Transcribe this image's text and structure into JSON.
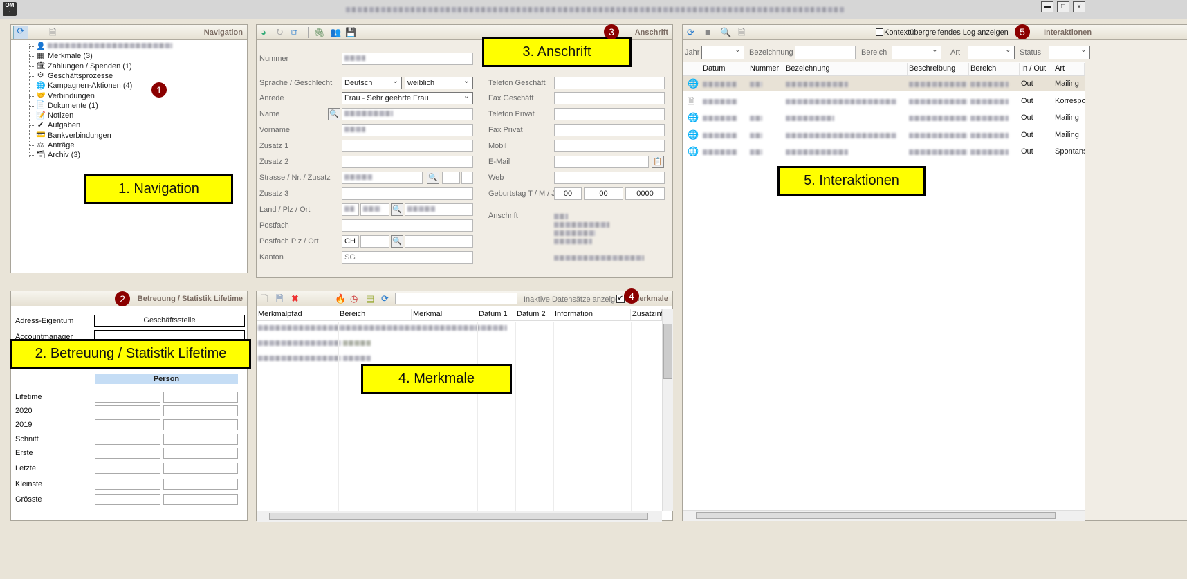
{
  "window": {
    "logo": "OM",
    "controls": [
      "▬",
      "□",
      "x"
    ]
  },
  "navigation": {
    "title": "Navigation",
    "badge": "1",
    "callout": "1. Navigation",
    "items": [
      {
        "label": "",
        "icon": "person-icon",
        "glyph": "👤"
      },
      {
        "label": "Merkmale (3)",
        "icon": "blocks-icon",
        "glyph": "▦"
      },
      {
        "label": "Zahlungen / Spenden (1)",
        "icon": "bank-icon",
        "glyph": "🏛"
      },
      {
        "label": "Geschäftsprozesse",
        "icon": "gear-icon",
        "glyph": "⚙"
      },
      {
        "label": "Kampagnen-Aktionen (4)",
        "icon": "globe-icon",
        "glyph": "🌐"
      },
      {
        "label": "Verbindungen",
        "icon": "handshake-icon",
        "glyph": "🤝"
      },
      {
        "label": "Dokumente (1)",
        "icon": "document-icon",
        "glyph": "📄"
      },
      {
        "label": "Notizen",
        "icon": "note-icon",
        "glyph": "📝"
      },
      {
        "label": "Aufgaben",
        "icon": "checkmark-icon",
        "glyph": "✔"
      },
      {
        "label": "Bankverbindungen",
        "icon": "card-icon",
        "glyph": "💳"
      },
      {
        "label": "Anträge",
        "icon": "stamp-icon",
        "glyph": "⚖"
      },
      {
        "label": "Archiv (3)",
        "icon": "archive-icon",
        "glyph": "🗃"
      }
    ]
  },
  "betreuung": {
    "title": "Betreuung / Statistik Lifetime",
    "badge": "2",
    "callout": "2. Betreuung / Statistik Lifetime",
    "adress_eigentum_label": "Adress-Eigentum",
    "adress_eigentum_value": "Geschäftsstelle",
    "accountmanager_label": "Accountmanager",
    "person_header": "Person",
    "rows": [
      "Lifetime",
      "2020",
      "2019",
      "Schnitt",
      "Erste",
      "Letzte",
      "Kleinste",
      "Grösste"
    ]
  },
  "anschrift": {
    "title": "Anschrift",
    "badge": "3",
    "callout": "3. Anschrift",
    "left": [
      {
        "label": "Nummer"
      },
      {
        "label": "Sprache / Geschlecht",
        "value1": "Deutsch",
        "value2": "weiblich"
      },
      {
        "label": "Anrede",
        "value": "Frau -  Sehr geehrte Frau"
      },
      {
        "label": "Name"
      },
      {
        "label": "Vorname"
      },
      {
        "label": "Zusatz 1"
      },
      {
        "label": "Zusatz 2"
      },
      {
        "label": "Strasse / Nr. / Zusatz"
      },
      {
        "label": "Zusatz 3"
      },
      {
        "label": "Land / Plz / Ort"
      },
      {
        "label": "Postfach"
      },
      {
        "label": "Postfach Plz / Ort",
        "value": "CH"
      },
      {
        "label": "Kanton",
        "value": "SG"
      }
    ],
    "right": [
      "Telefon Geschäft",
      "Fax Geschäft",
      "Telefon Privat",
      "Fax Privat",
      "Mobil",
      "E-Mail",
      "Web",
      "Geburtstag  T / M / J"
    ],
    "birthday": [
      "00",
      "00",
      "0000"
    ],
    "address_label": "Anschrift"
  },
  "merkmale": {
    "title": "Merkmale",
    "badge": "4",
    "callout": "4. Merkmale",
    "inactive_label": "Inaktive Datensätze anzeigen",
    "inactive_checked": true,
    "search_value": "",
    "columns": [
      "Merkmalpfad",
      "Bereich",
      "Merkmal",
      "Datum 1",
      "Datum 2",
      "Information",
      "Zusatzinfo"
    ]
  },
  "interaktionen": {
    "title": "Interaktionen",
    "badge": "5",
    "callout": "5. Interaktionen",
    "context_log_label": "Kontextübergreifendes Log anzeigen",
    "context_log_checked": false,
    "filters": {
      "jahr": "Jahr",
      "bezeichnung": "Bezeichnung",
      "bereich": "Bereich",
      "art": "Art",
      "status": "Status"
    },
    "columns": [
      "Datum",
      "Nummer",
      "Bezeichnung",
      "Beschreibung",
      "Bereich",
      "In / Out",
      "Art"
    ],
    "rows": [
      {
        "icon": "globe-icon",
        "in_out": "Out",
        "art": "Mailing"
      },
      {
        "icon": "document-icon",
        "in_out": "Out",
        "art": "Korrespondenz"
      },
      {
        "icon": "globe-icon",
        "in_out": "Out",
        "art": "Mailing"
      },
      {
        "icon": "globe-icon",
        "in_out": "Out",
        "art": "Mailing"
      },
      {
        "icon": "globe-icon",
        "in_out": "Out",
        "art": "Spontanspende"
      }
    ]
  },
  "colors": {
    "callout": "#ffff00",
    "badge": "#8b0000",
    "background": "#e9e4d8"
  }
}
